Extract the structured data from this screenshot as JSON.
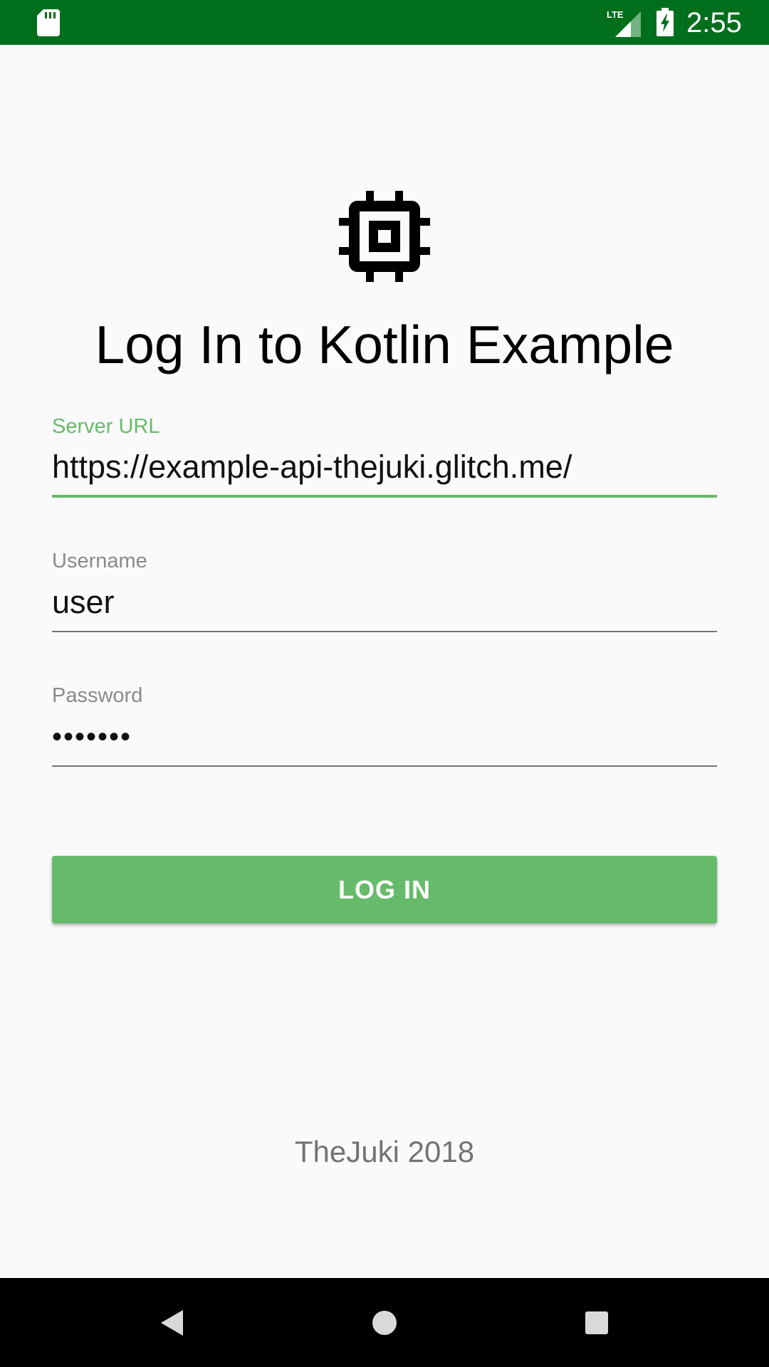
{
  "status_bar": {
    "time": "2:55",
    "network_label": "LTE",
    "background_color": "#006f1c",
    "icons": [
      "sd-card-icon",
      "lte-signal-icon",
      "battery-charging-icon"
    ]
  },
  "login": {
    "logo_icon": "chip-icon",
    "title": "Log In to Kotlin Example",
    "fields": {
      "server_url": {
        "label": "Server URL",
        "value": "https://example-api-thejuki.glitch.me/",
        "focused": true
      },
      "username": {
        "label": "Username",
        "value": "user"
      },
      "password": {
        "label": "Password",
        "masked_value": "•••••••"
      }
    },
    "login_button_label": "LOG IN",
    "footer": "TheJuki 2018"
  },
  "colors": {
    "accent": "#66bb6a",
    "status_bar": "#006f1c",
    "background": "#fafafa",
    "hint_text": "#8a8a8a"
  },
  "nav_bar": {
    "icons": [
      "back-icon",
      "home-icon",
      "recents-icon"
    ]
  }
}
